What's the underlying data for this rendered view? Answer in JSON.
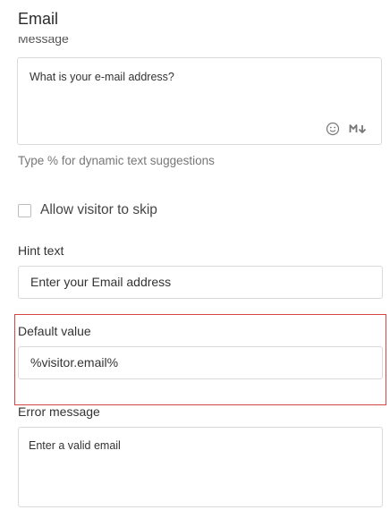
{
  "header": {
    "title": "Email"
  },
  "message": {
    "label": "Message",
    "value": "What is your e-mail address?",
    "icons": [
      "emoji-icon",
      "markdown-icon"
    ],
    "helper": "Type % for dynamic text suggestions"
  },
  "skip": {
    "label": "Allow visitor to skip",
    "checked": false
  },
  "hint": {
    "label": "Hint text",
    "value": "Enter your Email address"
  },
  "default": {
    "label": "Default value",
    "value": "%visitor.email%",
    "highlight_color": "#d64545"
  },
  "error": {
    "label": "Error message",
    "value": "Enter a valid email"
  }
}
